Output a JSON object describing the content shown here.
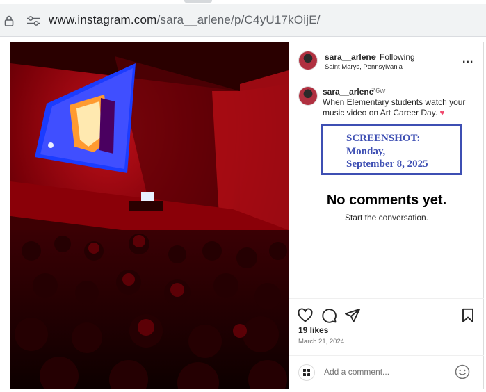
{
  "browser": {
    "url_domain": "www.instagram.com",
    "url_path": "/sara__arlene/p/C4yU17kOijE/",
    "lock_icon": "lock-icon",
    "site_settings_icon": "tune-icon"
  },
  "post": {
    "header": {
      "username": "sara__arlene",
      "separator": "•",
      "follow_status": "Following",
      "location": "Saint Marys, Pennsylvania",
      "more_label": "..."
    },
    "caption": {
      "username": "sara__arlene",
      "age": "76w",
      "text": "When Elementary students watch your music video on Art Career Day.",
      "emoji": "♥"
    },
    "stamp": {
      "line1": "SCREENSHOT:",
      "line2": "Monday,",
      "line3": "September 8, 2025"
    },
    "comments": {
      "empty_title": "No comments yet.",
      "empty_subtitle": "Start the conversation."
    },
    "likes": "19 likes",
    "date": "March 21, 2024",
    "add_comment_placeholder": "Add a comment...",
    "colors": {
      "accent_stamp": "#3e4fb3",
      "heart": "#f0476c"
    }
  }
}
